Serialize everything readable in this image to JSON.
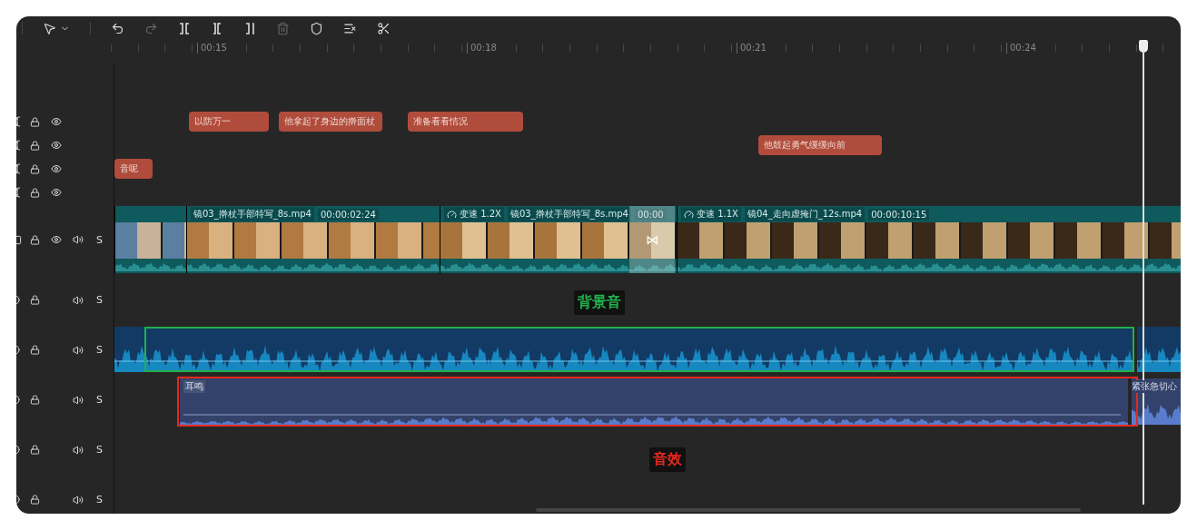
{
  "toolbar": {
    "tools": [
      {
        "kind": "select",
        "disabled": false
      },
      {
        "kind": "undo",
        "disabled": false
      },
      {
        "kind": "redo",
        "disabled": true
      },
      {
        "kind": "split",
        "disabled": false
      },
      {
        "kind": "split-left",
        "disabled": false
      },
      {
        "kind": "split-right",
        "disabled": false
      },
      {
        "kind": "delete",
        "disabled": true
      },
      {
        "kind": "marker",
        "disabled": false
      },
      {
        "kind": "caption",
        "disabled": false
      },
      {
        "kind": "smart-cut",
        "disabled": false
      }
    ]
  },
  "ruler": {
    "labels": [
      "00:15",
      "00:18",
      "00:21",
      "00:24"
    ]
  },
  "tracks": [
    {
      "kind": "text",
      "clips": [
        "以防万一",
        "他拿起了身边的擀面杖",
        "准备看看情况"
      ]
    },
    {
      "kind": "text",
      "clips": [
        "他鼓起勇气缓缓向前"
      ]
    },
    {
      "kind": "text",
      "clips": [
        "音呢"
      ]
    },
    {
      "kind": "text"
    },
    {
      "kind": "video",
      "solo_label": "S",
      "transition": "⋈",
      "segments": [
        {
          "kind": "clip"
        },
        {
          "kind": "clip",
          "name": "镜03_擀杖手部特写_8s.mp4",
          "duration": "00:00:02:24"
        },
        {
          "kind": "clip",
          "speed": "变速 1.2X",
          "name": "镜03_擀杖手部特写_8s.mp4",
          "duration": "00:00"
        },
        {
          "kind": "clip",
          "speed": "变速 1.1X",
          "name": "镜04_走向虚掩门_12s.mp4",
          "duration": "00:00:10:15"
        }
      ]
    },
    {
      "kind": "audio",
      "solo_label": "S"
    },
    {
      "kind": "audio",
      "solo_label": "S",
      "clips": [
        {
          "kind": "music"
        },
        {
          "kind": "music"
        }
      ]
    },
    {
      "kind": "audio",
      "solo_label": "S",
      "clips": [
        {
          "kind": "effect",
          "name": "耳鸣"
        },
        {
          "kind": "effect",
          "name": "紧张急切心"
        }
      ]
    },
    {
      "kind": "audio",
      "solo_label": "S"
    },
    {
      "kind": "audio",
      "solo_label": "S"
    }
  ],
  "annotations": [
    {
      "text": "背景音",
      "color": "#22b04b"
    },
    {
      "text": "音效",
      "color": "#e5281c"
    }
  ]
}
